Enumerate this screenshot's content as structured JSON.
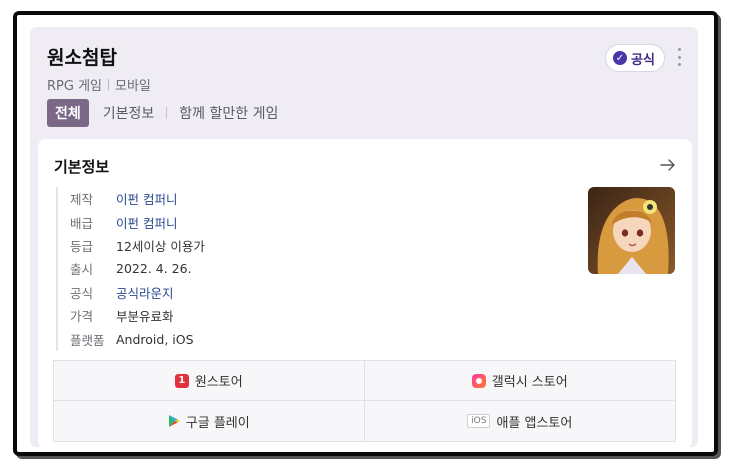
{
  "header": {
    "title": "원소첨탑",
    "genre": "RPG 게임",
    "platform_type": "모바일",
    "official_badge": "공식"
  },
  "tabs": [
    {
      "label": "전체",
      "active": true
    },
    {
      "label": "기본정보",
      "active": false
    },
    {
      "label": "함께 할만한 게임",
      "active": false
    }
  ],
  "card": {
    "title": "기본정보",
    "rows": [
      {
        "key": "제작",
        "value": "이펀 컴퍼니"
      },
      {
        "key": "배급",
        "value": "이펀 컴퍼니"
      },
      {
        "key": "등급",
        "value": "12세이상 이용가"
      },
      {
        "key": "출시",
        "value": "2022. 4. 26."
      },
      {
        "key": "공식",
        "value": "공식라운지"
      },
      {
        "key": "가격",
        "value": "부분유료화"
      },
      {
        "key": "플랫폼",
        "value": "Android, iOS"
      }
    ]
  },
  "stores": [
    {
      "label": "원스토어",
      "icon": "onestore-icon",
      "icon_text": "1"
    },
    {
      "label": "갤럭시 스토어",
      "icon": "galaxy-store-icon"
    },
    {
      "label": "구글 플레이",
      "icon": "google-play-icon"
    },
    {
      "label": "애플 앱스토어",
      "icon": "ios-icon",
      "icon_text": "iOS"
    }
  ],
  "colors": {
    "active_tab": "#7b6887",
    "link": "#2a4a8f",
    "badge": "#4a36a8",
    "panel_bg": "#efedf3"
  }
}
